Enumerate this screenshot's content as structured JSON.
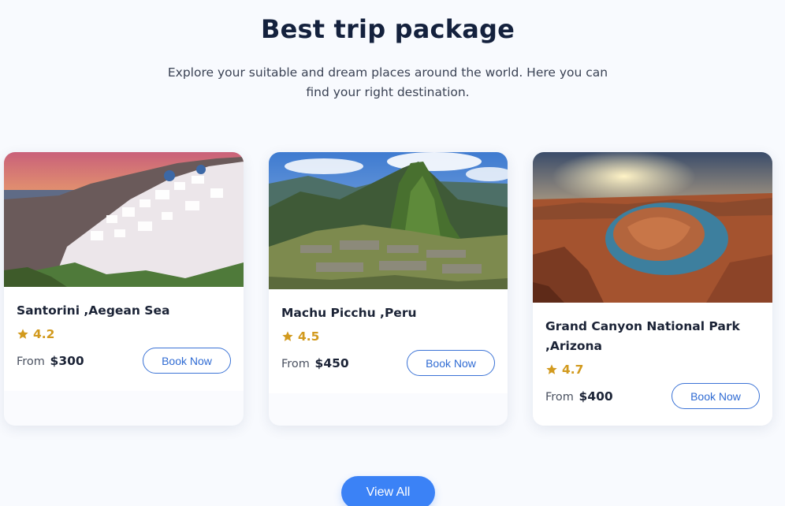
{
  "section": {
    "title": "Best trip package",
    "subtitle_line1": "Explore your suitable and dream places around the world. Here you can",
    "subtitle_line2": "find your right destination."
  },
  "packages": [
    {
      "name_line1": "Santorini ,Aegean Sea",
      "name_line2": "",
      "rating": "4.2",
      "from_label": "From",
      "price": "$300",
      "button": "Book Now"
    },
    {
      "name_line1": "Machu Picchu ,Peru",
      "name_line2": "",
      "rating": "4.5",
      "from_label": "From",
      "price": "$450",
      "button": "Book Now"
    },
    {
      "name_line1": "Grand Canyon National Park",
      "name_line2": ",Arizona",
      "rating": "4.7",
      "from_label": "From",
      "price": "$400",
      "button": "Book Now"
    }
  ],
  "view_all": "View All",
  "colors": {
    "accent": "#3b82f6",
    "star": "#d29a1e",
    "heading": "#14213d"
  },
  "icons": {
    "rating": "star-icon"
  }
}
